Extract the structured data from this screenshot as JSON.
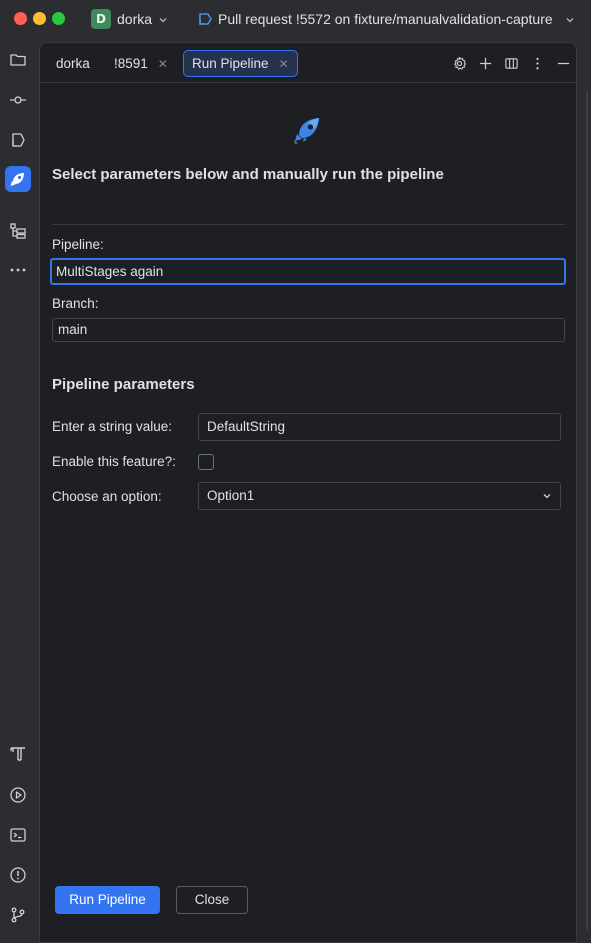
{
  "titlebar": {
    "project_badge": "D",
    "project_name": "dorka",
    "pr_title": "Pull request !5572 on fixture/manualvalidation-capture"
  },
  "toolstrip": {
    "top_icons": [
      "folder-icon",
      "commit-icon",
      "pull-requests-icon",
      "azure-pipelines-icon",
      "structure-icon",
      "more-icon"
    ],
    "bottom_icons": [
      "terraform-icon",
      "run-icon",
      "terminal-icon",
      "problems-icon",
      "git-branch-icon"
    ]
  },
  "tabs": [
    {
      "label": "dorka",
      "closable": false,
      "active": false
    },
    {
      "label": "!8591",
      "closable": true,
      "active": false
    },
    {
      "label": "Run Pipeline",
      "closable": true,
      "active": true
    }
  ],
  "tab_close_glyph": "✕",
  "form": {
    "heading": "Select parameters below and manually run the pipeline",
    "pipeline_label": "Pipeline:",
    "pipeline_value": "MultiStages again",
    "branch_label": "Branch:",
    "branch_value": "main",
    "params_heading": "Pipeline parameters",
    "string_label": "Enter a string value:",
    "string_value": "DefaultString",
    "feature_label": "Enable this feature?:",
    "feature_checked": false,
    "option_label": "Choose an option:",
    "option_value": "Option1"
  },
  "buttons": {
    "run": "Run Pipeline",
    "close": "Close"
  },
  "colors": {
    "accent": "#3574f0",
    "panel_bg": "#1e1f22",
    "chrome_bg": "#2b2d30"
  }
}
